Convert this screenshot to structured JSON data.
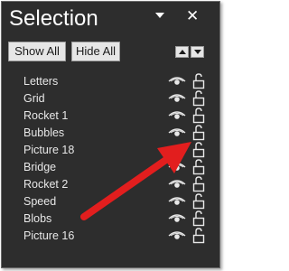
{
  "pane": {
    "title": "Selection",
    "dropdown_icon": "dropdown-arrow-icon",
    "close_label": "✕"
  },
  "buttons": {
    "show_all": "Show All",
    "hide_all": "Hide All"
  },
  "items": [
    {
      "label": "Letters"
    },
    {
      "label": "Grid"
    },
    {
      "label": "Rocket 1"
    },
    {
      "label": "Bubbles"
    },
    {
      "label": "Picture 18"
    },
    {
      "label": "Bridge"
    },
    {
      "label": "Rocket 2"
    },
    {
      "label": "Speed"
    },
    {
      "label": "Blobs"
    },
    {
      "label": "Picture 16"
    }
  ],
  "colors": {
    "pane_bg": "#2d2d2d",
    "arrow": "#e21e1e"
  }
}
